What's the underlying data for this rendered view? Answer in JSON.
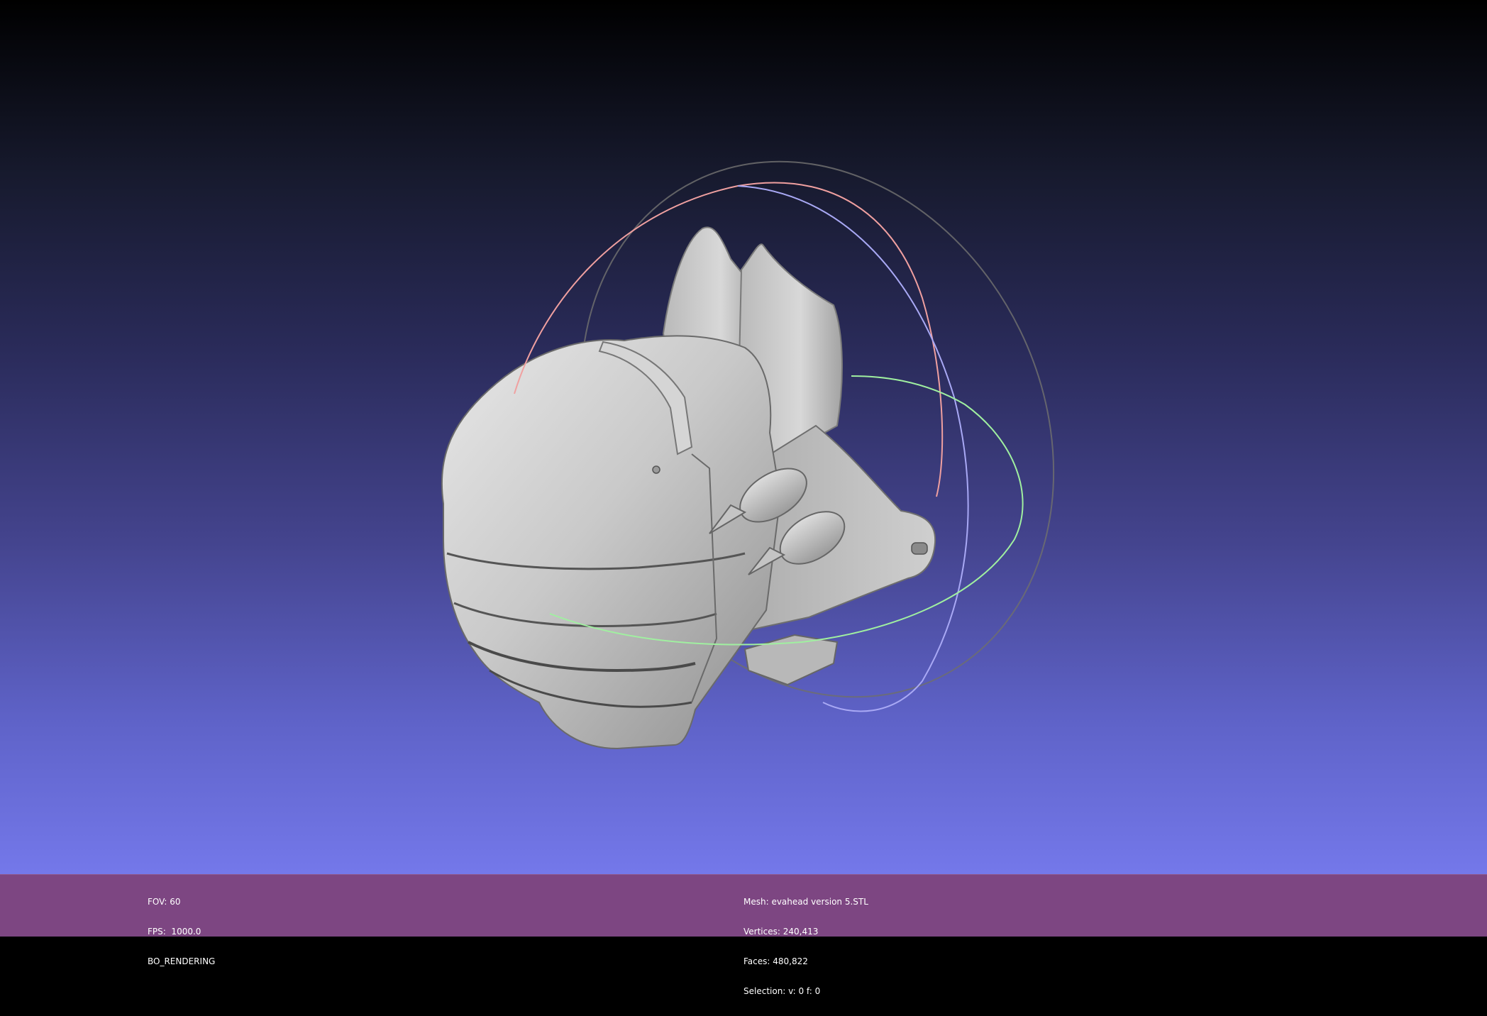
{
  "viewer": {
    "left_info": {
      "fov": "FOV: 60",
      "fps": "FPS:  1000.0",
      "render_mode": "BO_RENDERING"
    },
    "mesh_info": {
      "mesh": "Mesh: evahead version 5.STL",
      "vertices": "Vertices: 240,413",
      "faces": "Faces: 480,822",
      "selection": "Selection: v: 0 f: 0"
    }
  },
  "colors": {
    "status_bar": "#7d4682",
    "trackball_x": "#f0a0a0",
    "trackball_y": "#a0f0a0",
    "trackball_z": "#a0a0f0",
    "mesh": "#c8c8c8"
  },
  "icons": {
    "trackball": "trackball-gizmo",
    "model": "3d-mesh-model"
  }
}
